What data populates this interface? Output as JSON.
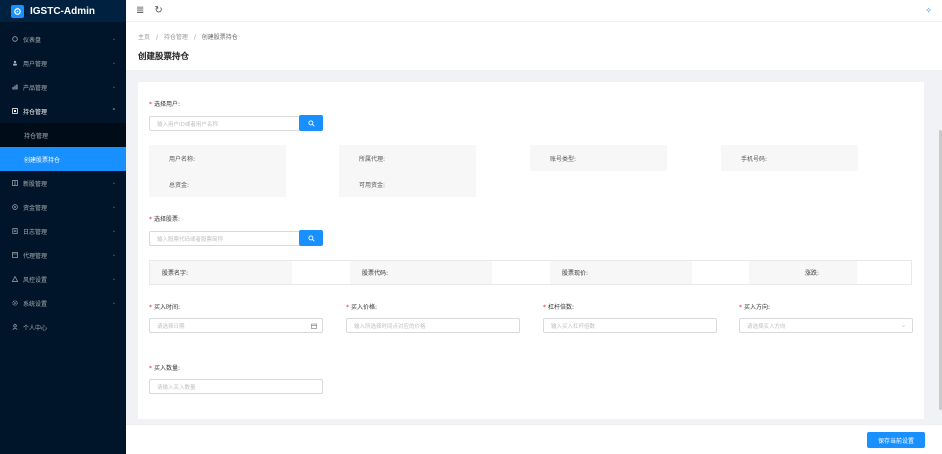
{
  "app": {
    "title": "IGSTC-Admin"
  },
  "sidebar": {
    "items": [
      {
        "label": "仪表盘",
        "icon": "dashboard-icon"
      },
      {
        "label": "用户管理",
        "icon": "users-icon"
      },
      {
        "label": "产品管理",
        "icon": "chart-icon"
      },
      {
        "label": "持仓管理",
        "icon": "position-icon",
        "open": true
      },
      {
        "label": "新股管理",
        "icon": "grid-icon"
      },
      {
        "label": "资金管理",
        "icon": "money-icon"
      },
      {
        "label": "日志管理",
        "icon": "log-icon"
      },
      {
        "label": "代理管理",
        "icon": "agent-icon"
      },
      {
        "label": "风控设置",
        "icon": "warning-icon"
      },
      {
        "label": "系统设置",
        "icon": "gear-icon"
      },
      {
        "label": "个人中心",
        "icon": "person-icon"
      }
    ],
    "subitems": [
      {
        "label": "持仓管理"
      },
      {
        "label": "创建股票持仓",
        "active": true
      }
    ]
  },
  "breadcrumb": {
    "home": "主页",
    "sep": "/",
    "parent": "持仓管理",
    "current": "创建股票持仓"
  },
  "page": {
    "title": "创建股票持仓"
  },
  "user_select": {
    "label": "选择用户:",
    "placeholder": "输入用户ID或者用户名称",
    "info": [
      {
        "label": "用户名称:",
        "value": ""
      },
      {
        "label": "所属代理:",
        "value": ""
      },
      {
        "label": "账号类型:",
        "value": ""
      },
      {
        "label": "手机号码:",
        "value": ""
      },
      {
        "label": "总资金:",
        "value": ""
      },
      {
        "label": "可用资金:",
        "value": ""
      }
    ]
  },
  "stock_select": {
    "label": "选择股票:",
    "placeholder": "输入股票代码或者股票简称",
    "columns": [
      {
        "label": "股票名字:",
        "value": ""
      },
      {
        "label": "股票代码:",
        "value": ""
      },
      {
        "label": "股票现价:",
        "value": ""
      },
      {
        "label": "涨跌:",
        "value": ""
      }
    ]
  },
  "form": {
    "buy_time": {
      "label": "买入时间:",
      "placeholder": "请选择日期"
    },
    "buy_price": {
      "label": "买入价格:",
      "placeholder": "输入所选择时间点对应的价格"
    },
    "leverage": {
      "label": "杠杆倍数:",
      "placeholder": "输入买入杠杆倍数"
    },
    "direction": {
      "label": "买入方向:",
      "placeholder": "请选择买入方向"
    },
    "quantity": {
      "label": "买入数量:",
      "placeholder": "请输入买入数量"
    }
  },
  "footer": {
    "save_label": "保存当前设置"
  },
  "colors": {
    "primary": "#1890ff",
    "sidebar": "#001529",
    "required": "#f5222d"
  }
}
